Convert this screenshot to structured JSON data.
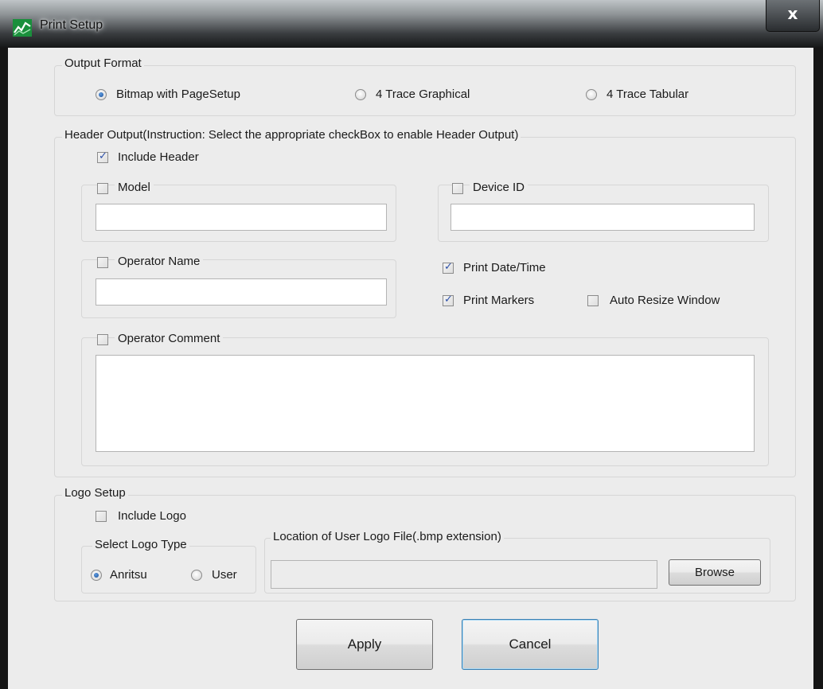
{
  "window": {
    "title": "Print Setup",
    "close_glyph": "x",
    "icon": "app-logo-icon"
  },
  "output_format": {
    "title": "Output Format",
    "options": [
      {
        "label": "Bitmap with PageSetup",
        "checked": true
      },
      {
        "label": "4 Trace Graphical",
        "checked": false
      },
      {
        "label": "4 Trace Tabular",
        "checked": false
      }
    ]
  },
  "header_output": {
    "title": "Header Output(Instruction: Select the appropriate checkBox to enable Header Output)",
    "include_header": {
      "label": "Include Header",
      "checked": true
    },
    "model": {
      "label": "Model",
      "checked": false,
      "value": ""
    },
    "device_id": {
      "label": "Device ID",
      "checked": false,
      "value": ""
    },
    "operator_name": {
      "label": "Operator Name",
      "checked": false,
      "value": ""
    },
    "print_datetime": {
      "label": "Print Date/Time",
      "checked": true
    },
    "print_markers": {
      "label": "Print Markers",
      "checked": true
    },
    "auto_resize": {
      "label": "Auto Resize Window",
      "checked": false
    },
    "operator_comment": {
      "label": "Operator Comment",
      "checked": false,
      "value": ""
    }
  },
  "logo_setup": {
    "title": "Logo Setup",
    "include_logo": {
      "label": "Include Logo",
      "checked": false
    },
    "logo_type": {
      "title": "Select Logo Type",
      "options": [
        {
          "label": "Anritsu",
          "checked": true
        },
        {
          "label": "User",
          "checked": false
        }
      ]
    },
    "location": {
      "title": "Location of User Logo File(.bmp extension)",
      "value": "",
      "browse_label": "Browse"
    }
  },
  "buttons": {
    "apply": "Apply",
    "cancel": "Cancel"
  }
}
